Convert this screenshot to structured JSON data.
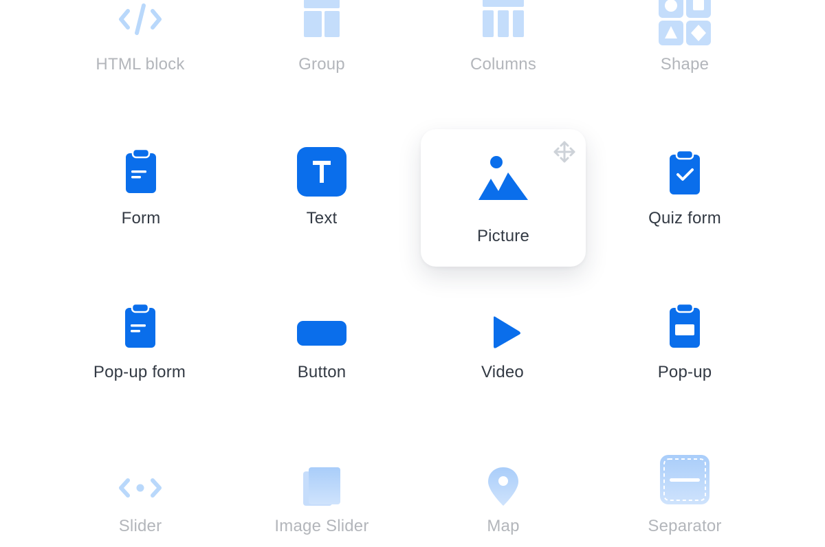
{
  "colors": {
    "accent": "#0a6eeb",
    "accent_light": "#b9d8fb",
    "label_active": "#333a44",
    "label_faded": "#b3b6bb"
  },
  "blocks": [
    {
      "label": "HTML block",
      "icon": "code-icon",
      "state": "faded"
    },
    {
      "label": "Group",
      "icon": "group-layout-icon",
      "state": "faded"
    },
    {
      "label": "Columns",
      "icon": "columns-icon",
      "state": "faded"
    },
    {
      "label": "Shape",
      "icon": "shapes-icon",
      "state": "faded"
    },
    {
      "label": "Form",
      "icon": "clipboard-form-icon",
      "state": "active"
    },
    {
      "label": "Text",
      "icon": "text-t-icon",
      "state": "active"
    },
    {
      "label": "Picture",
      "icon": "picture-icon",
      "state": "selected"
    },
    {
      "label": "Quiz form",
      "icon": "clipboard-check-icon",
      "state": "active"
    },
    {
      "label": "Pop-up form",
      "icon": "clipboard-popup-form-icon",
      "state": "active"
    },
    {
      "label": "Button",
      "icon": "button-icon",
      "state": "active"
    },
    {
      "label": "Video",
      "icon": "play-icon",
      "state": "active"
    },
    {
      "label": "Pop-up",
      "icon": "popup-window-icon",
      "state": "active"
    },
    {
      "label": "Slider",
      "icon": "slider-arrows-icon",
      "state": "faded"
    },
    {
      "label": "Image Slider",
      "icon": "image-stack-icon",
      "state": "faded"
    },
    {
      "label": "Map",
      "icon": "map-pin-icon",
      "state": "faded"
    },
    {
      "label": "Separator",
      "icon": "separator-icon",
      "state": "faded"
    }
  ],
  "drag_handle_icon": "move-arrows-icon"
}
